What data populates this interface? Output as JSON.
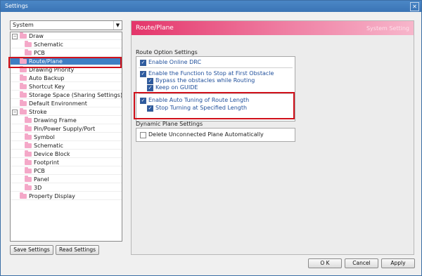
{
  "window": {
    "title": "Settings"
  },
  "sidebar": {
    "selector_value": "System",
    "tree": [
      {
        "label": "Draw",
        "level": 0,
        "expander": "-"
      },
      {
        "label": "Schematic",
        "level": 1
      },
      {
        "label": "PCB",
        "level": 1
      },
      {
        "label": "Route/Plane",
        "level": 0,
        "selected": true
      },
      {
        "label": "Drawing Priority",
        "level": 0
      },
      {
        "label": "Auto Backup",
        "level": 0
      },
      {
        "label": "Shortcut Key",
        "level": 0
      },
      {
        "label": "Storage Space (Sharing Settings)",
        "level": 0
      },
      {
        "label": "Default Environment",
        "level": 0
      },
      {
        "label": "Stroke",
        "level": 0,
        "expander": "-"
      },
      {
        "label": "Drawing Frame",
        "level": 1
      },
      {
        "label": "Pin/Power Supply/Port",
        "level": 1
      },
      {
        "label": "Symbol",
        "level": 1
      },
      {
        "label": "Schematic",
        "level": 1
      },
      {
        "label": "Device Block",
        "level": 1
      },
      {
        "label": "Footprint",
        "level": 1
      },
      {
        "label": "PCB",
        "level": 1
      },
      {
        "label": "Panel",
        "level": 1
      },
      {
        "label": "3D",
        "level": 1
      },
      {
        "label": "Property Display",
        "level": 0
      }
    ],
    "save_settings": "Save Settings",
    "read_settings": "Read Settings"
  },
  "panel": {
    "title": "Route/Plane",
    "subtitle": "System Setting",
    "route_section": "Route Option Settings",
    "options": {
      "online_drc": "Enable Online DRC",
      "stop_first_obstacle": "Enable the Function to Stop at First Obstacle",
      "bypass_obstacles": "Bypass the obstacles while Routing",
      "keep_on_guide": "Keep on GUIDE",
      "auto_tuning": "Enable Auto Tuning of Route Length",
      "stop_turning": "Stop Turning at Specified Length"
    },
    "dynamic_section": "Dynamic Plane Settings",
    "delete_unconnected": "Delete Unconnected Plane Automatically"
  },
  "footer": {
    "ok": "O K",
    "cancel": "Cancel",
    "apply": "Apply"
  },
  "colors": {
    "accent_pink": "#e4356a",
    "selection_blue": "#3f7fc4",
    "highlight_red": "#d0101a"
  }
}
